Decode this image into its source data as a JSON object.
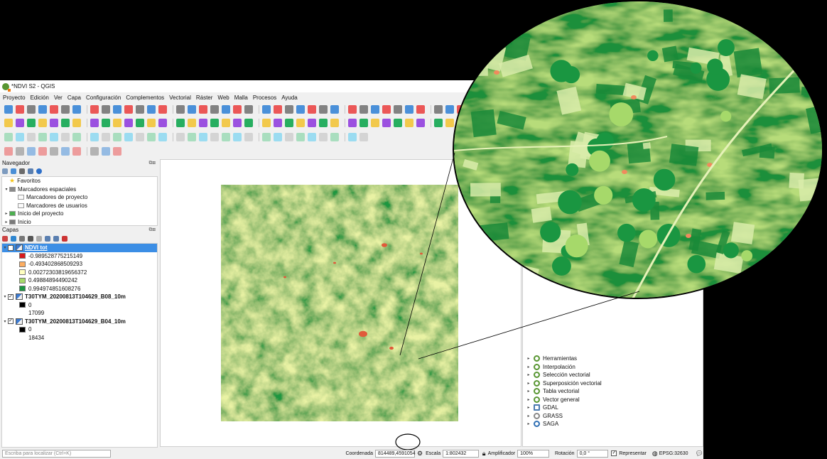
{
  "window": {
    "title": "*NDVI S2 - QGIS"
  },
  "menu": [
    "Proyecto",
    "Edición",
    "Ver",
    "Capa",
    "Configuración",
    "Complementos",
    "Vectorial",
    "Ráster",
    "Web",
    "Malla",
    "Procesos",
    "Ayuda"
  ],
  "navigator": {
    "title": "Navegador",
    "items": [
      {
        "label": "Favoritos",
        "indent": 0,
        "icon": "star-icon"
      },
      {
        "label": "Marcadores espaciales",
        "indent": 0,
        "icon": "bookmark-icon"
      },
      {
        "label": "Marcadores de proyecto",
        "indent": 1,
        "icon": "folder-icon"
      },
      {
        "label": "Marcadores de usuarios",
        "indent": 1,
        "icon": "folder-icon"
      },
      {
        "label": "Inicio del proyecto",
        "indent": 0,
        "icon": "project-home-icon"
      },
      {
        "label": "Inicio",
        "indent": 0,
        "icon": "home-icon"
      }
    ]
  },
  "layers": {
    "title": "Capas",
    "list": [
      {
        "name": "NDVI tot",
        "selected": true,
        "classes": [
          {
            "color": "#d7191c",
            "label": "-0.989528775215149"
          },
          {
            "color": "#fdae61",
            "label": "-0.493402868509293"
          },
          {
            "color": "#ffffc0",
            "label": "0.00272303819656372"
          },
          {
            "color": "#a6d96a",
            "label": "0.49884894490242"
          },
          {
            "color": "#1a9641",
            "label": "0.994974851608276"
          }
        ]
      },
      {
        "name": "T30TYM_20200813T104629_B08_10m",
        "selected": false,
        "classes": [
          {
            "color": "#000000",
            "label": "0"
          },
          {
            "color": "#ffffff",
            "label": "17099"
          }
        ]
      },
      {
        "name": "T30TYM_20200813T104629_B04_10m",
        "selected": false,
        "classes": [
          {
            "color": "#000000",
            "label": "0"
          },
          {
            "color": "#ffffff",
            "label": "18434"
          }
        ]
      }
    ]
  },
  "processing": [
    "Herramientas",
    "Interpolación",
    "Selección vectorial",
    "Superposición vectorial",
    "Tabla vectorial",
    "Vector general",
    "GDAL",
    "GRASS",
    "SAGA"
  ],
  "status": {
    "locator_placeholder": "Escriba para localizar (Ctrl+K)",
    "coord_label": "Coordenada",
    "coord_value": "814489,4591054",
    "scale_label": "Escala",
    "scale_value": "1:802432",
    "magnifier_label": "Amplificador",
    "magnifier_value": "100%",
    "rotation_label": "Rotación",
    "rotation_value": "0,0 °",
    "render_label": "Representar",
    "crs": "EPSG:32630"
  },
  "colors": {
    "accent": "#3c8ee5",
    "qgis_green": "#589632"
  }
}
